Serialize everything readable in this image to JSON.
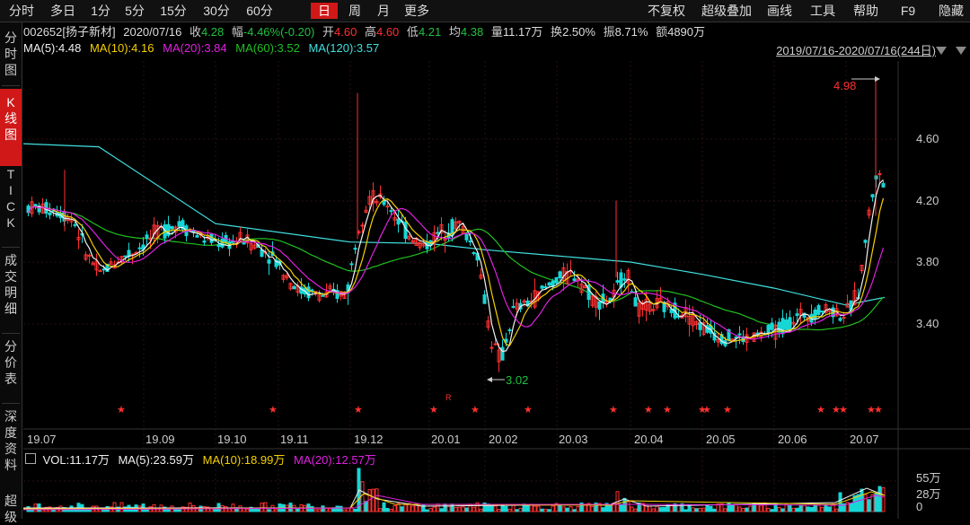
{
  "toolbar": {
    "left": [
      "分时",
      "多日",
      "1分",
      "5分",
      "15分",
      "30分",
      "60分",
      "日",
      "周",
      "月",
      "更多"
    ],
    "active_period": "日",
    "right": [
      "不复权",
      "超级叠加",
      "画线",
      "工具",
      "帮助",
      "F9",
      "隐藏"
    ]
  },
  "left_tabs": [
    "分时图",
    "K线图",
    "TICK",
    "成交明细",
    "分价表",
    "深度资料",
    "超级"
  ],
  "active_left_tab": "K线图",
  "stock": {
    "code_name": "002652[扬子新材]",
    "date": "2020/07/16",
    "close_label": "收",
    "close": "4.28",
    "change_label": "幅",
    "change": "-4.46%(-0.20)",
    "open_label": "开",
    "open": "4.60",
    "high_label": "高",
    "high": "4.60",
    "low_label": "低",
    "low": "4.21",
    "avg_label": "均",
    "avg": "4.38",
    "vol_label": "量",
    "vol": "11.17万",
    "turnover_label": "换",
    "turnover": "2.50%",
    "amplitude_label": "振",
    "amplitude": "8.71%",
    "amount_label": "额",
    "amount": "4890万"
  },
  "ma": {
    "ma5": "MA(5):4.48",
    "ma10": "MA(10):4.16",
    "ma20": "MA(20):3.84",
    "ma60": "MA(60):3.52",
    "ma120": "MA(120):3.57"
  },
  "date_range": "2019/07/16-2020/07/16(244日)",
  "price_axis": [
    "4.60",
    "4.20",
    "3.80",
    "3.40"
  ],
  "date_axis": [
    "19.07",
    "19.09",
    "19.10",
    "19.11",
    "19.12",
    "20.01",
    "20.02",
    "20.03",
    "20.04",
    "20.05",
    "20.06",
    "20.07"
  ],
  "annotations": {
    "high": "4.98",
    "low": "3.02",
    "marker": "R"
  },
  "volume": {
    "vol": "VOL:11.17万",
    "ma5": "MA(5):23.59万",
    "ma10": "MA(10):18.99万",
    "ma20": "MA(20):12.57万",
    "axis": [
      "55万",
      "28万",
      "0"
    ]
  },
  "colors": {
    "up": "#ff3030",
    "down": "#17d6d6",
    "ma5": "#f0f0f0",
    "ma10": "#f5d000",
    "ma20": "#e020e0",
    "ma60": "#20c020",
    "ma120": "#40e0e0",
    "active": "#d01818",
    "green_text": "#20c040",
    "red_text": "#ff3030"
  }
}
